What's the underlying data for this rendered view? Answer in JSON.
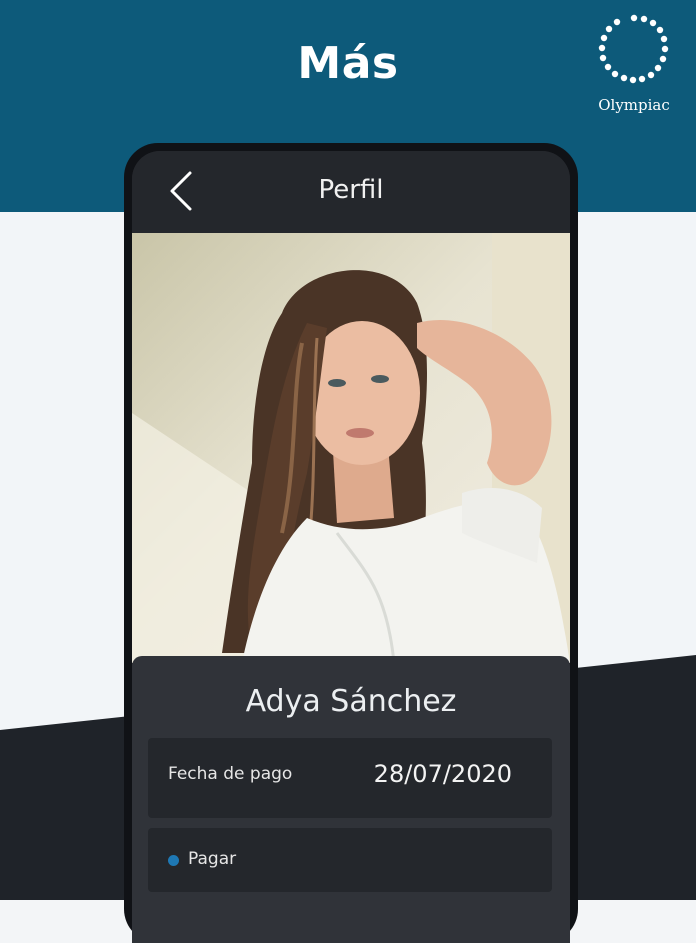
{
  "promo": {
    "title": "Más"
  },
  "brand": {
    "name": "Olympiac"
  },
  "app": {
    "title": "Perfil",
    "back_icon": "chevron-left-icon",
    "profile": {
      "photo": "profile-photo",
      "name": "Adya Sánchez"
    },
    "payment": {
      "date_label": "Fecha de pago",
      "date_value": "28/07/2020"
    },
    "action": {
      "label": "Pagar",
      "dot_color": "#1e78b4"
    }
  },
  "colors": {
    "header_bg": "#0d5a7a",
    "light_bg": "#f2f5f8",
    "dark_bg": "#1f2329",
    "card_bg": "#303339",
    "row_bg": "#24272c"
  }
}
